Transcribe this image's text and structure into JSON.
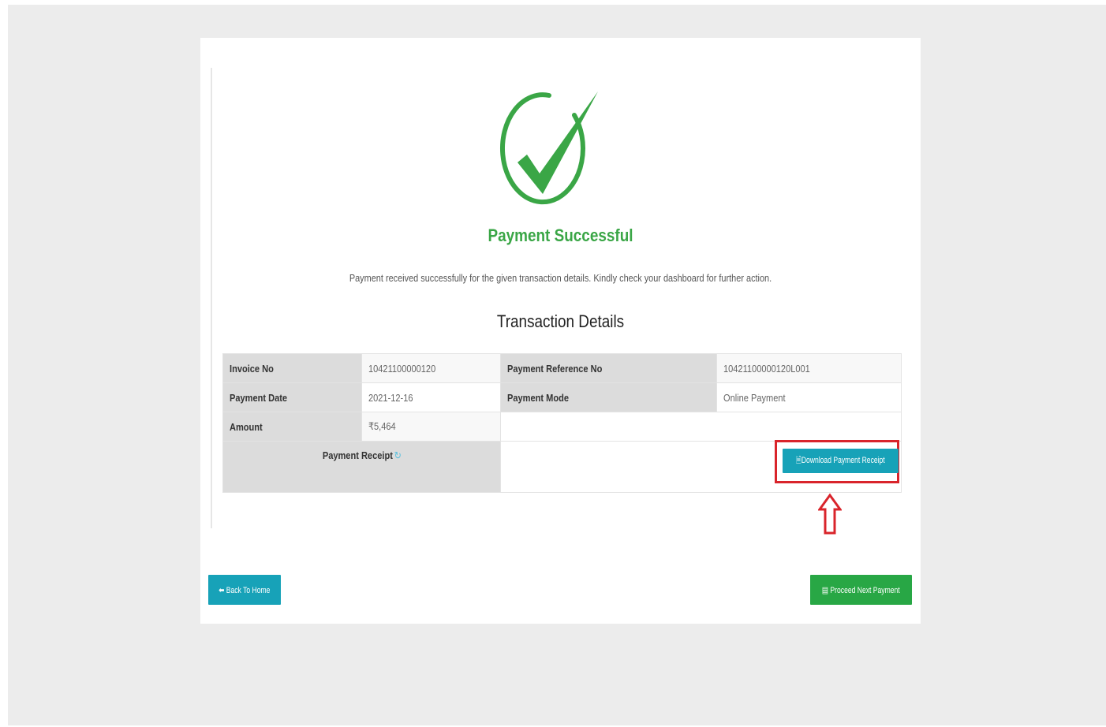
{
  "status": {
    "title": "Payment Successful",
    "message": "Payment received successfully for the given transaction details. Kindly check your dashboard for further action.",
    "icon": "check-circle-icon",
    "color": "#3aa646"
  },
  "transaction": {
    "heading": "Transaction Details",
    "invoice_no_label": "Invoice No",
    "invoice_no": "10421100000120",
    "reference_no_label": "Payment Reference No",
    "reference_no": "10421100000120L001",
    "payment_date_label": "Payment Date",
    "payment_date": "2021-12-16",
    "payment_mode_label": "Payment Mode",
    "payment_mode": "Online Payment",
    "amount_label": "Amount",
    "amount": "₹5,464",
    "receipt_label": "Payment Receipt",
    "receipt_icon": "external-link-icon"
  },
  "buttons": {
    "download_receipt": "Download Payment Receipt",
    "back_home": "Back To Home",
    "proceed_next": "Proceed Next Payment"
  },
  "colors": {
    "info": "#17a2b8",
    "success": "#28a745",
    "highlight": "#d9242b"
  }
}
